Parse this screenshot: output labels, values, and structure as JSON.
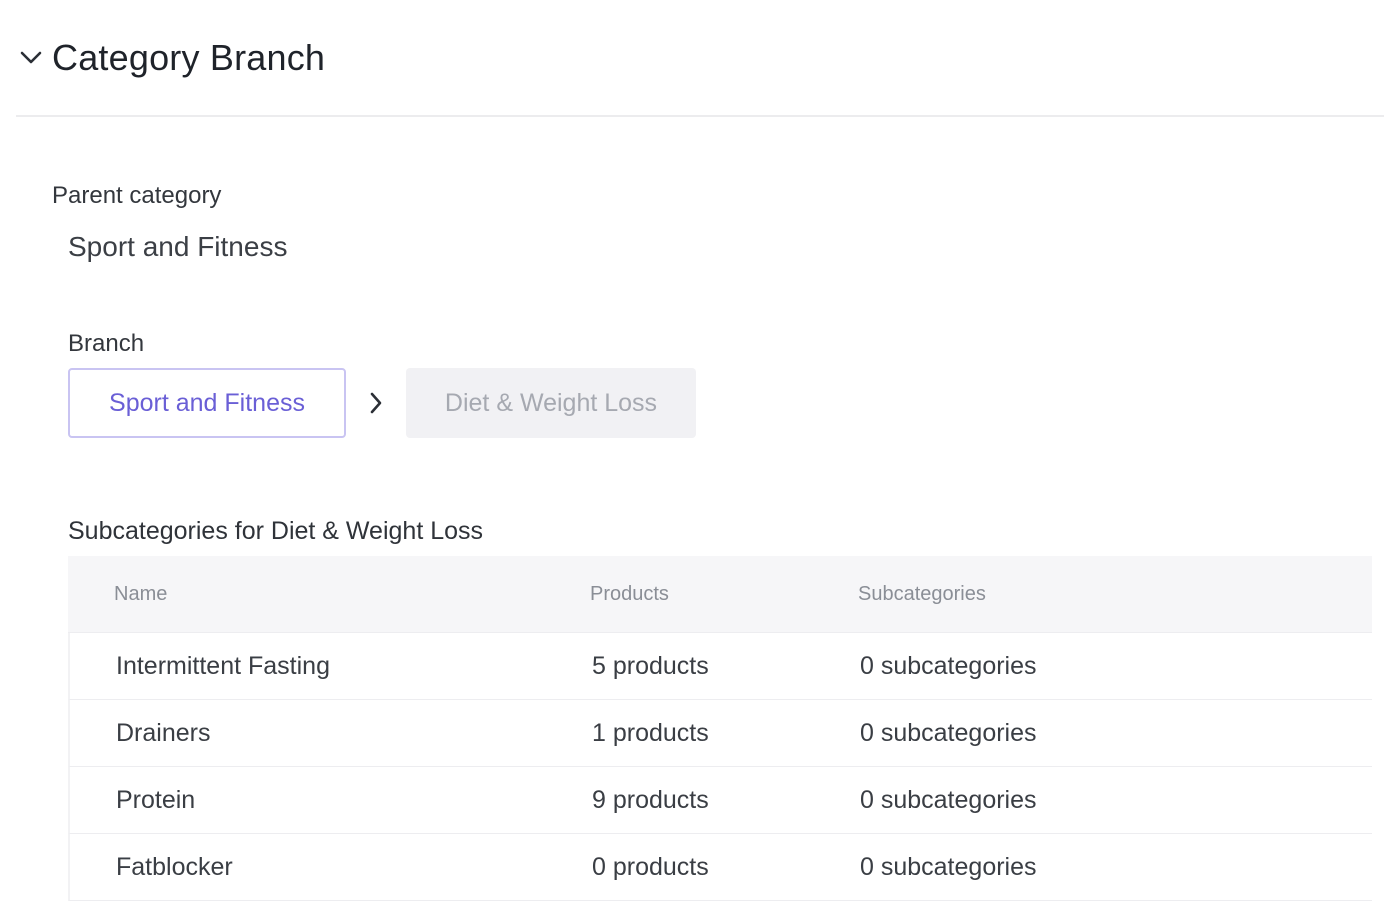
{
  "section": {
    "title": "Category Branch"
  },
  "parent": {
    "label": "Parent category",
    "value": "Sport and Fitness"
  },
  "branch": {
    "label": "Branch",
    "items": [
      "Sport and Fitness",
      "Diet & Weight Loss"
    ]
  },
  "subcategories": {
    "title": "Subcategories for Diet & Weight Loss",
    "columns": [
      "Name",
      "Products",
      "Subcategories"
    ],
    "rows": [
      {
        "name": "Intermittent Fasting",
        "products": "5 products",
        "subcategories": "0 subcategories"
      },
      {
        "name": "Drainers",
        "products": "1 products",
        "subcategories": "0 subcategories"
      },
      {
        "name": "Protein",
        "products": "9 products",
        "subcategories": "0 subcategories"
      },
      {
        "name": "Fatblocker",
        "products": "0 products",
        "subcategories": "0 subcategories"
      }
    ]
  },
  "colors": {
    "accent": "#6a5fd6",
    "accent_border": "#c9c4f2",
    "header_bg": "#f6f6f8"
  },
  "icons": {
    "collapse": "chevron-down-icon",
    "separator": "chevron-right-icon"
  }
}
